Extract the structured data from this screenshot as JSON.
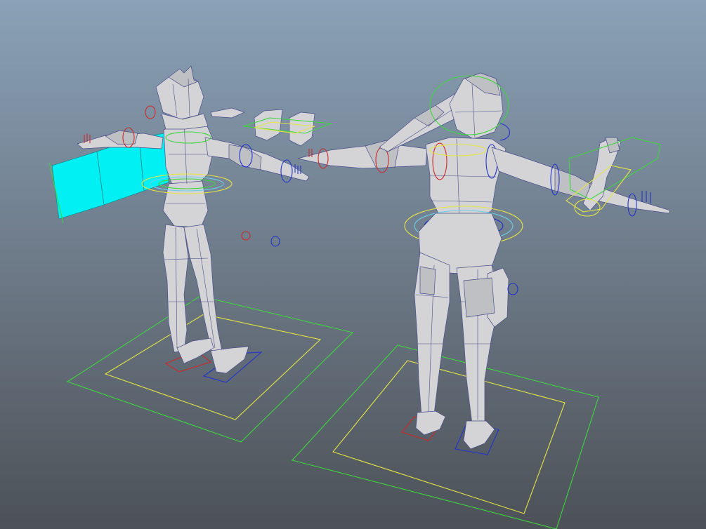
{
  "viewport": {
    "background_top": "#8aa1b7",
    "background_bottom": "#4c5157"
  },
  "colors": {
    "mesh_fill": "#d4d4d6",
    "wireframe": "#4a4e8a",
    "selected_face": "#00f0f4",
    "control_green": "#3ed53e",
    "control_yellow": "#e4e445",
    "control_blue": "#2233cc",
    "control_red": "#cc2a2a"
  },
  "scene": {
    "objects": [
      {
        "id": "character-left",
        "icon": "rigged-mesh"
      },
      {
        "id": "character-right",
        "icon": "rigged-mesh"
      }
    ]
  }
}
